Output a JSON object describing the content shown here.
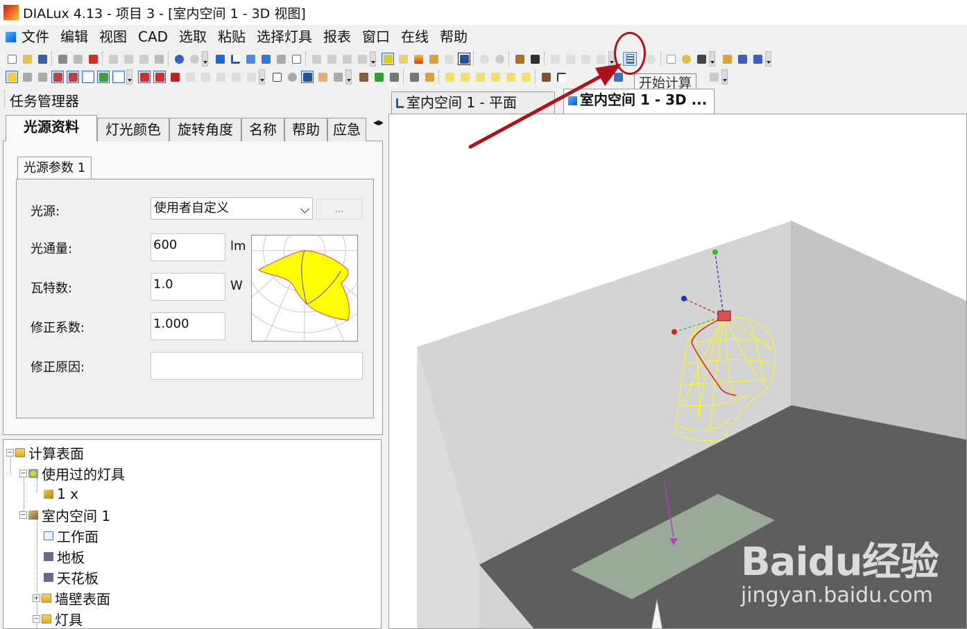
{
  "window": {
    "title": "DIALux 4.13 - 项目 3 - [室内空间 1 - 3D 视图]"
  },
  "menu": [
    "文件",
    "编辑",
    "视图",
    "CAD",
    "选取",
    "粘贴",
    "选择灯具",
    "报表",
    "窗口",
    "在线",
    "帮助"
  ],
  "toolbar": {
    "tooltip": "开始计算",
    "highlighted_button": "calculator-icon"
  },
  "task_manager": {
    "title": "任务管理器",
    "tabs": [
      "光源资料",
      "灯光颜色",
      "旋转角度",
      "名称",
      "帮助",
      "应急"
    ],
    "active_tab": "光源资料",
    "subtab": "光源参数 1",
    "fields": {
      "source": {
        "label": "光源:",
        "value": "使用者自定义",
        "button": "..."
      },
      "flux": {
        "label": "光通量:",
        "value": "600",
        "unit": "lm"
      },
      "watts": {
        "label": "瓦特数:",
        "value": "1.0",
        "unit": "W"
      },
      "factor": {
        "label": "修正系数:",
        "value": "1.000"
      },
      "reason": {
        "label": "修正原因:",
        "value": ""
      }
    }
  },
  "tree": {
    "items": [
      {
        "label": "计算表面",
        "icon": "folder-icon",
        "toggle": "−"
      },
      {
        "label": "使用过的灯具",
        "icon": "luminaires-icon",
        "toggle": "−"
      },
      {
        "label": "1 x",
        "icon": "luminaire-icon"
      },
      {
        "label": "室内空间 1",
        "icon": "room-icon",
        "toggle": "−"
      },
      {
        "label": "工作面",
        "icon": "workplane-icon"
      },
      {
        "label": "地板",
        "icon": "floor-icon"
      },
      {
        "label": "天花板",
        "icon": "ceiling-icon"
      },
      {
        "label": "墙壁表面",
        "icon": "folder-icon",
        "toggle": "+"
      },
      {
        "label": "灯具",
        "icon": "folder-icon",
        "toggle": "−"
      }
    ]
  },
  "view_tabs": [
    "室内空间 1 - 平面",
    "室内空间 1 - 3D ..."
  ],
  "active_view_tab": "室内空间 1 - 3D ...",
  "watermark": {
    "main": "Baidu经验",
    "url": "jingyan.baidu.com"
  },
  "colors": {
    "annotation": "#b0101a",
    "light_distribution": "#ffff00",
    "wall": "#d4d4d4",
    "floor": "#5e5e5e",
    "workplane": "#9aaa98"
  }
}
